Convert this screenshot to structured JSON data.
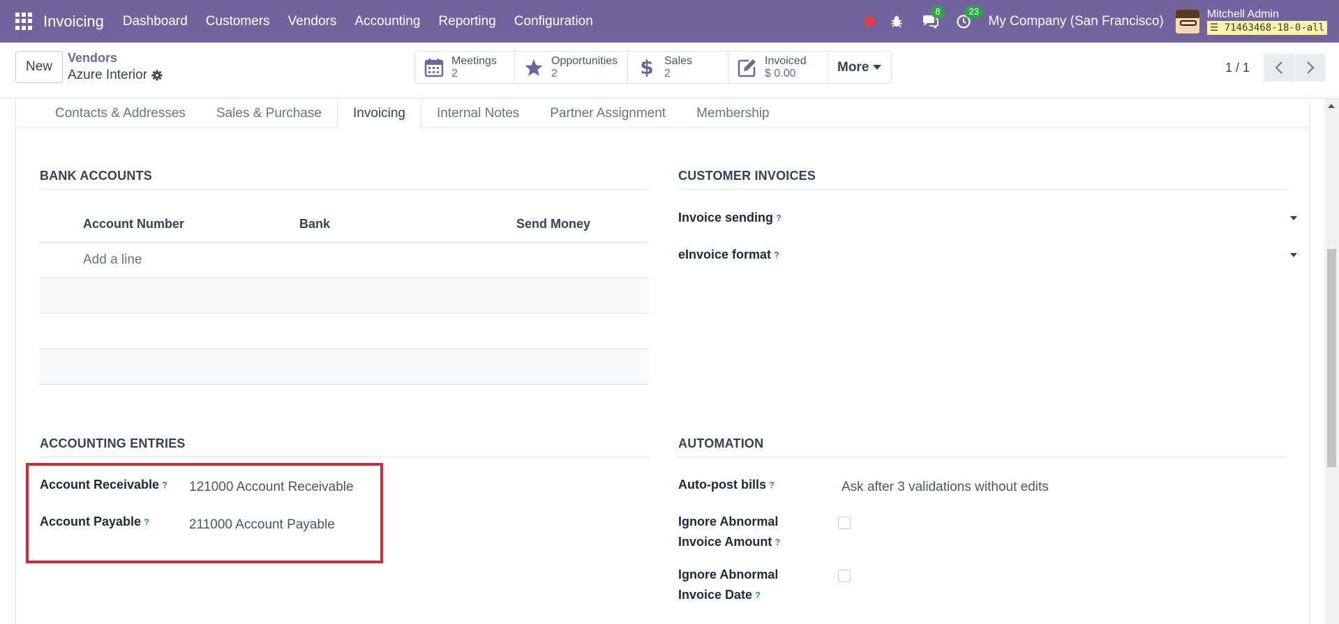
{
  "navbar": {
    "app_name": "Invoicing",
    "menu": [
      "Dashboard",
      "Customers",
      "Vendors",
      "Accounting",
      "Reporting",
      "Configuration"
    ],
    "messages_count": "8",
    "activities_count": "23",
    "company": "My Company (San Francisco)",
    "user_name": "Mitchell Admin",
    "database": "71463468-18-0-all"
  },
  "control": {
    "new_label": "New",
    "breadcrumb_parent": "Vendors",
    "breadcrumb_current": "Azure Interior",
    "smart_buttons": [
      {
        "label": "Meetings",
        "value": "2",
        "icon": "calendar-icon"
      },
      {
        "label": "Opportunities",
        "value": "2",
        "icon": "star-icon"
      },
      {
        "label": "Sales",
        "value": "2",
        "icon": "dollar-icon"
      },
      {
        "label": "Invoiced",
        "value": "$ 0.00",
        "icon": "edit-icon"
      }
    ],
    "more_label": "More",
    "pager": "1 / 1"
  },
  "tabs": [
    "Contacts & Addresses",
    "Sales & Purchase",
    "Invoicing",
    "Internal Notes",
    "Partner Assignment",
    "Membership"
  ],
  "active_tab": "Invoicing",
  "bank_accounts": {
    "title": "BANK ACCOUNTS",
    "columns": [
      "Account Number",
      "Bank",
      "Send Money"
    ],
    "add_line": "Add a line"
  },
  "customer_invoices": {
    "title": "CUSTOMER INVOICES",
    "invoice_sending_label": "Invoice sending",
    "einvoice_format_label": "eInvoice format"
  },
  "accounting_entries": {
    "title": "ACCOUNTING ENTRIES",
    "receivable_label": "Account Receivable",
    "receivable_value": "121000 Account Receivable",
    "payable_label": "Account Payable",
    "payable_value": "211000 Account Payable"
  },
  "automation": {
    "title": "AUTOMATION",
    "autopost_label": "Auto-post bills",
    "autopost_value": "Ask after 3 validations without edits",
    "ignore_amount_label_1": "Ignore Abnormal",
    "ignore_amount_label_2": "Invoice Amount",
    "ignore_date_label_1": "Ignore Abnormal",
    "ignore_date_label_2": "Invoice Date"
  },
  "qmark": "?",
  "colors": {
    "navbar": "#71639e",
    "highlight": "#d42a34",
    "badge": "#28a745"
  }
}
